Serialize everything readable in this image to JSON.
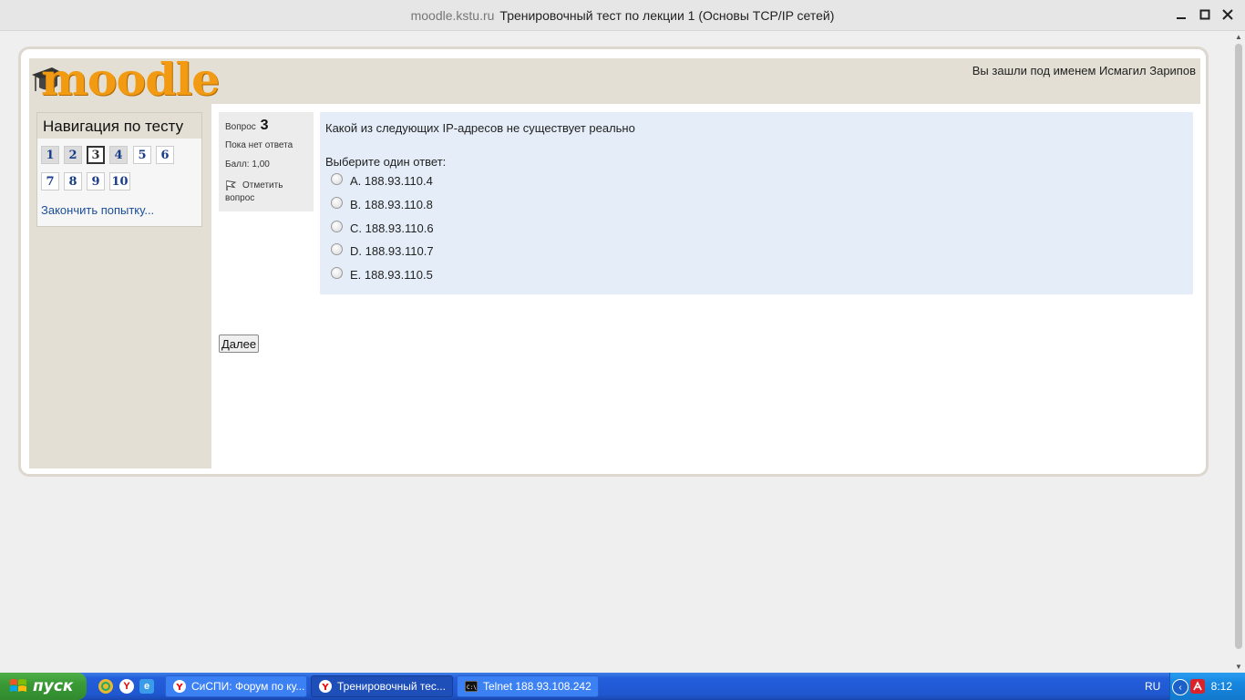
{
  "window": {
    "site": "moodle.kstu.ru",
    "title": "Тренировочный тест по лекции 1 (Основы TCP/IP сетей)"
  },
  "header": {
    "logo_text": "moodle",
    "login_info": "Вы зашли под именем Исмагил Зарипов"
  },
  "nav": {
    "title": "Навигация по тесту",
    "questions": [
      {
        "label": "1",
        "state": "answered"
      },
      {
        "label": "2",
        "state": "answered"
      },
      {
        "label": "3",
        "state": "current"
      },
      {
        "label": "4",
        "state": "answered"
      },
      {
        "label": "5",
        "state": "unanswered"
      },
      {
        "label": "6",
        "state": "unanswered"
      },
      {
        "label": "7",
        "state": "unanswered"
      },
      {
        "label": "8",
        "state": "unanswered"
      },
      {
        "label": "9",
        "state": "unanswered"
      },
      {
        "label": "10",
        "state": "unanswered"
      }
    ],
    "finish_link": "Закончить попытку..."
  },
  "question": {
    "number_prefix": "Вопрос",
    "number": "3",
    "state": "Пока нет ответа",
    "grade": "Балл: 1,00",
    "flag_line1": "Отметить",
    "flag_line2": "вопрос",
    "text": "Какой из следующих IP-адресов не существует реально",
    "prompt": "Выберите один ответ:",
    "answers": [
      "A. 188.93.110.4",
      "B. 188.93.110.8",
      "C. 188.93.110.6",
      "D. 188.93.110.7",
      "E. 188.93.110.5"
    ],
    "next_button": "Далее"
  },
  "taskbar": {
    "start_label": "пуск",
    "tasks": [
      "СиСПИ: Форум по ку...",
      "Тренировочный тес...",
      "Telnet 188.93.108.242"
    ],
    "language": "RU",
    "clock": "8:12"
  },
  "colors": {
    "accent_moodle": "#f19a12",
    "question_bg": "#e5eef8",
    "header_bg": "#e3dfd4",
    "taskbar_blue": "#245edb"
  }
}
